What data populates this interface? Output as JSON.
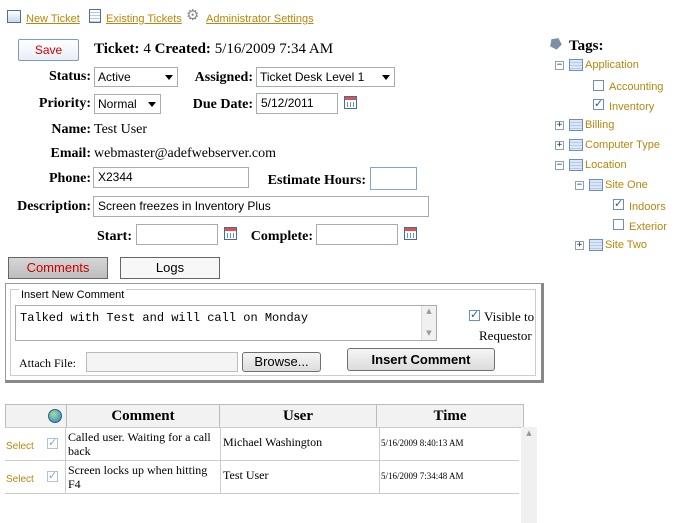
{
  "topnav": {
    "new_ticket": "New Ticket",
    "existing_tickets": "Existing Tickets",
    "admin_settings": "Administrator Settings"
  },
  "ticket": {
    "save_label": "Save",
    "ticket_label": "Ticket:",
    "ticket_number": "4",
    "created_label": "Created:",
    "created_value": "5/16/2009 7:34 AM",
    "status_label": "Status:",
    "status_value": "Active",
    "assigned_label": "Assigned:",
    "assigned_value": "Ticket Desk Level 1",
    "priority_label": "Priority:",
    "priority_value": "Normal",
    "due_date_label": "Due Date:",
    "due_date_value": "5/12/2011",
    "name_label": "Name:",
    "name_value": "Test User",
    "email_label": "Email:",
    "email_value": "webmaster@adefwebserver.com",
    "phone_label": "Phone:",
    "phone_value": "X2344",
    "estimate_label": "Estimate Hours:",
    "estimate_value": "",
    "description_label": "Description:",
    "description_value": "Screen freezes in Inventory Plus",
    "start_label": "Start:",
    "start_value": "",
    "complete_label": "Complete:",
    "complete_value": ""
  },
  "tabs": {
    "comments": "Comments",
    "logs": "Logs"
  },
  "comment_panel": {
    "legend": "Insert New Comment",
    "comment_text": "Talked with Test and will call on Monday",
    "visible_label_1": "Visible to",
    "visible_label_2": "Requestor",
    "attach_label": "Attach File:",
    "browse_label": "Browse...",
    "insert_label": "Insert Comment"
  },
  "grid": {
    "headers": [
      "Comment",
      "User",
      "Time"
    ],
    "rows": [
      {
        "select": "Select",
        "comment": "Called user. Waiting for a call back",
        "user": "Michael Washington",
        "time": "5/16/2009 8:40:13 AM"
      },
      {
        "select": "Select",
        "comment": "Screen locks up when hitting F4",
        "user": "Test User",
        "time": "5/16/2009 7:34:48 AM"
      }
    ]
  },
  "tags": {
    "title": "Tags:",
    "items": {
      "application": "Application",
      "accounting": "Accounting",
      "inventory": "Inventory",
      "billing": "Billing",
      "computer_type": "Computer Type",
      "location": "Location",
      "site_one": "Site One",
      "indoors": "Indoors",
      "exterior": "Exterior",
      "site_two": "Site Two"
    }
  },
  "colors": {
    "link": "#b8860b",
    "active_tab_text": "#cc0000",
    "save_text": "#cc0000"
  }
}
